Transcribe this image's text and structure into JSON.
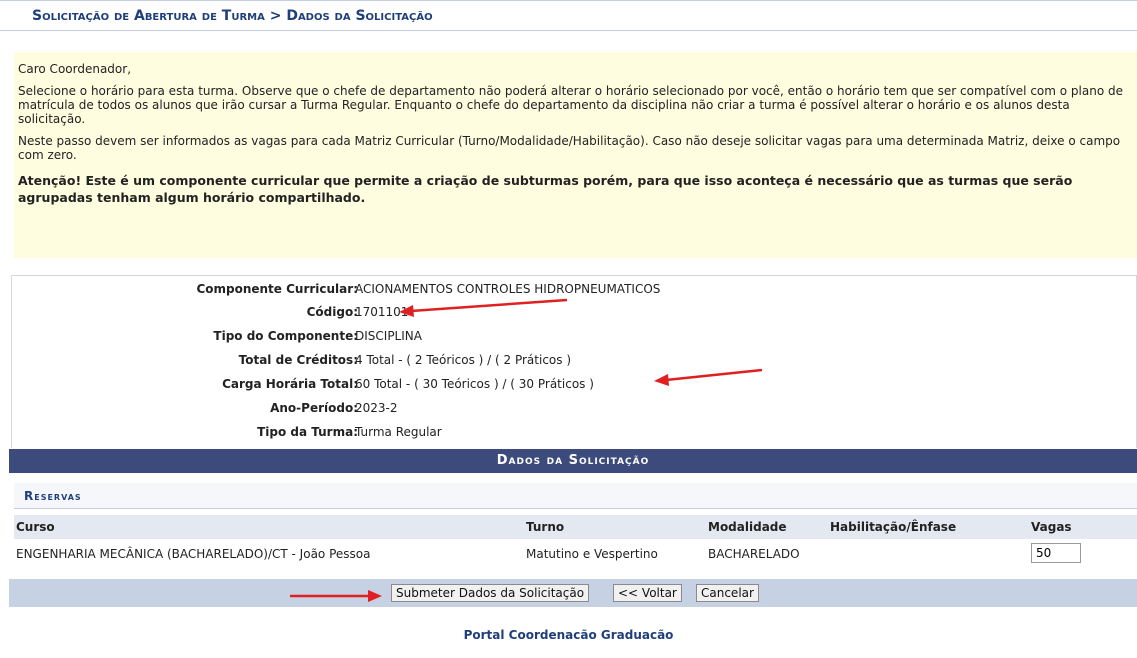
{
  "breadcrumb": "Solicitação de Abertura de Turma > Dados da Solicitação",
  "notice": {
    "greeting": "Caro Coordenador,",
    "p1": "Selecione o horário para esta turma. Observe que o chefe de departamento não poderá alterar o horário selecionado por você, então o horário tem que ser compatível com o plano de matrícula de todos os alunos que irão cursar a Turma Regular. Enquanto o chefe do departamento da disciplina não criar a turma é possível alterar o horário e os alunos desta solicitação.",
    "p2": "Neste passo devem ser informados as vagas para cada Matriz Curricular (Turno/Modalidade/Habilitação). Caso não deseje solicitar vagas para uma determinada Matriz, deixe o campo com zero.",
    "warning": "Atenção! Este é um componente curricular que permite a criação de subturmas porém, para que isso aconteça é necessário que as turmas que serão agrupadas tenham algum horário compartilhado."
  },
  "info": [
    {
      "label": "Componente Curricular:",
      "value": "ACIONAMENTOS CONTROLES HIDROPNEUMATICOS"
    },
    {
      "label": "Código:",
      "value": "1701101"
    },
    {
      "label": "Tipo do Componente:",
      "value": "DISCIPLINA"
    },
    {
      "label": "Total de Créditos:",
      "value": "4 Total - ( 2 Teóricos ) / ( 2 Práticos )"
    },
    {
      "label": "Carga Horária Total:",
      "value": "60 Total - ( 30 Teóricos ) / ( 30 Práticos )"
    },
    {
      "label": "Ano-Período:",
      "value": "2023-2"
    },
    {
      "label": "Tipo da Turma:",
      "value": "Turma Regular"
    }
  ],
  "dados_header": "Dados da Solicitação",
  "reservas_header": "Reservas",
  "table": {
    "headers": [
      "Curso",
      "Turno",
      "Modalidade",
      "Habilitação/Ênfase",
      "Vagas"
    ],
    "rows": [
      {
        "curso": "ENGENHARIA MECÂNICA (BACHARELADO)/CT - João Pessoa",
        "turno": "Matutino e Vespertino",
        "modalidade": "BACHARELADO",
        "habilitacao": "",
        "vagas": "50"
      }
    ]
  },
  "buttons": {
    "submit": "Submeter Dados da Solicitação",
    "back": "<< Voltar",
    "cancel": "Cancelar"
  },
  "footer": "Portal Coordenacão Graduacão",
  "colors": {
    "annotation_arrow": "#e02020",
    "header_bg": "#3c4b7c",
    "notice_bg": "#fefde0"
  }
}
